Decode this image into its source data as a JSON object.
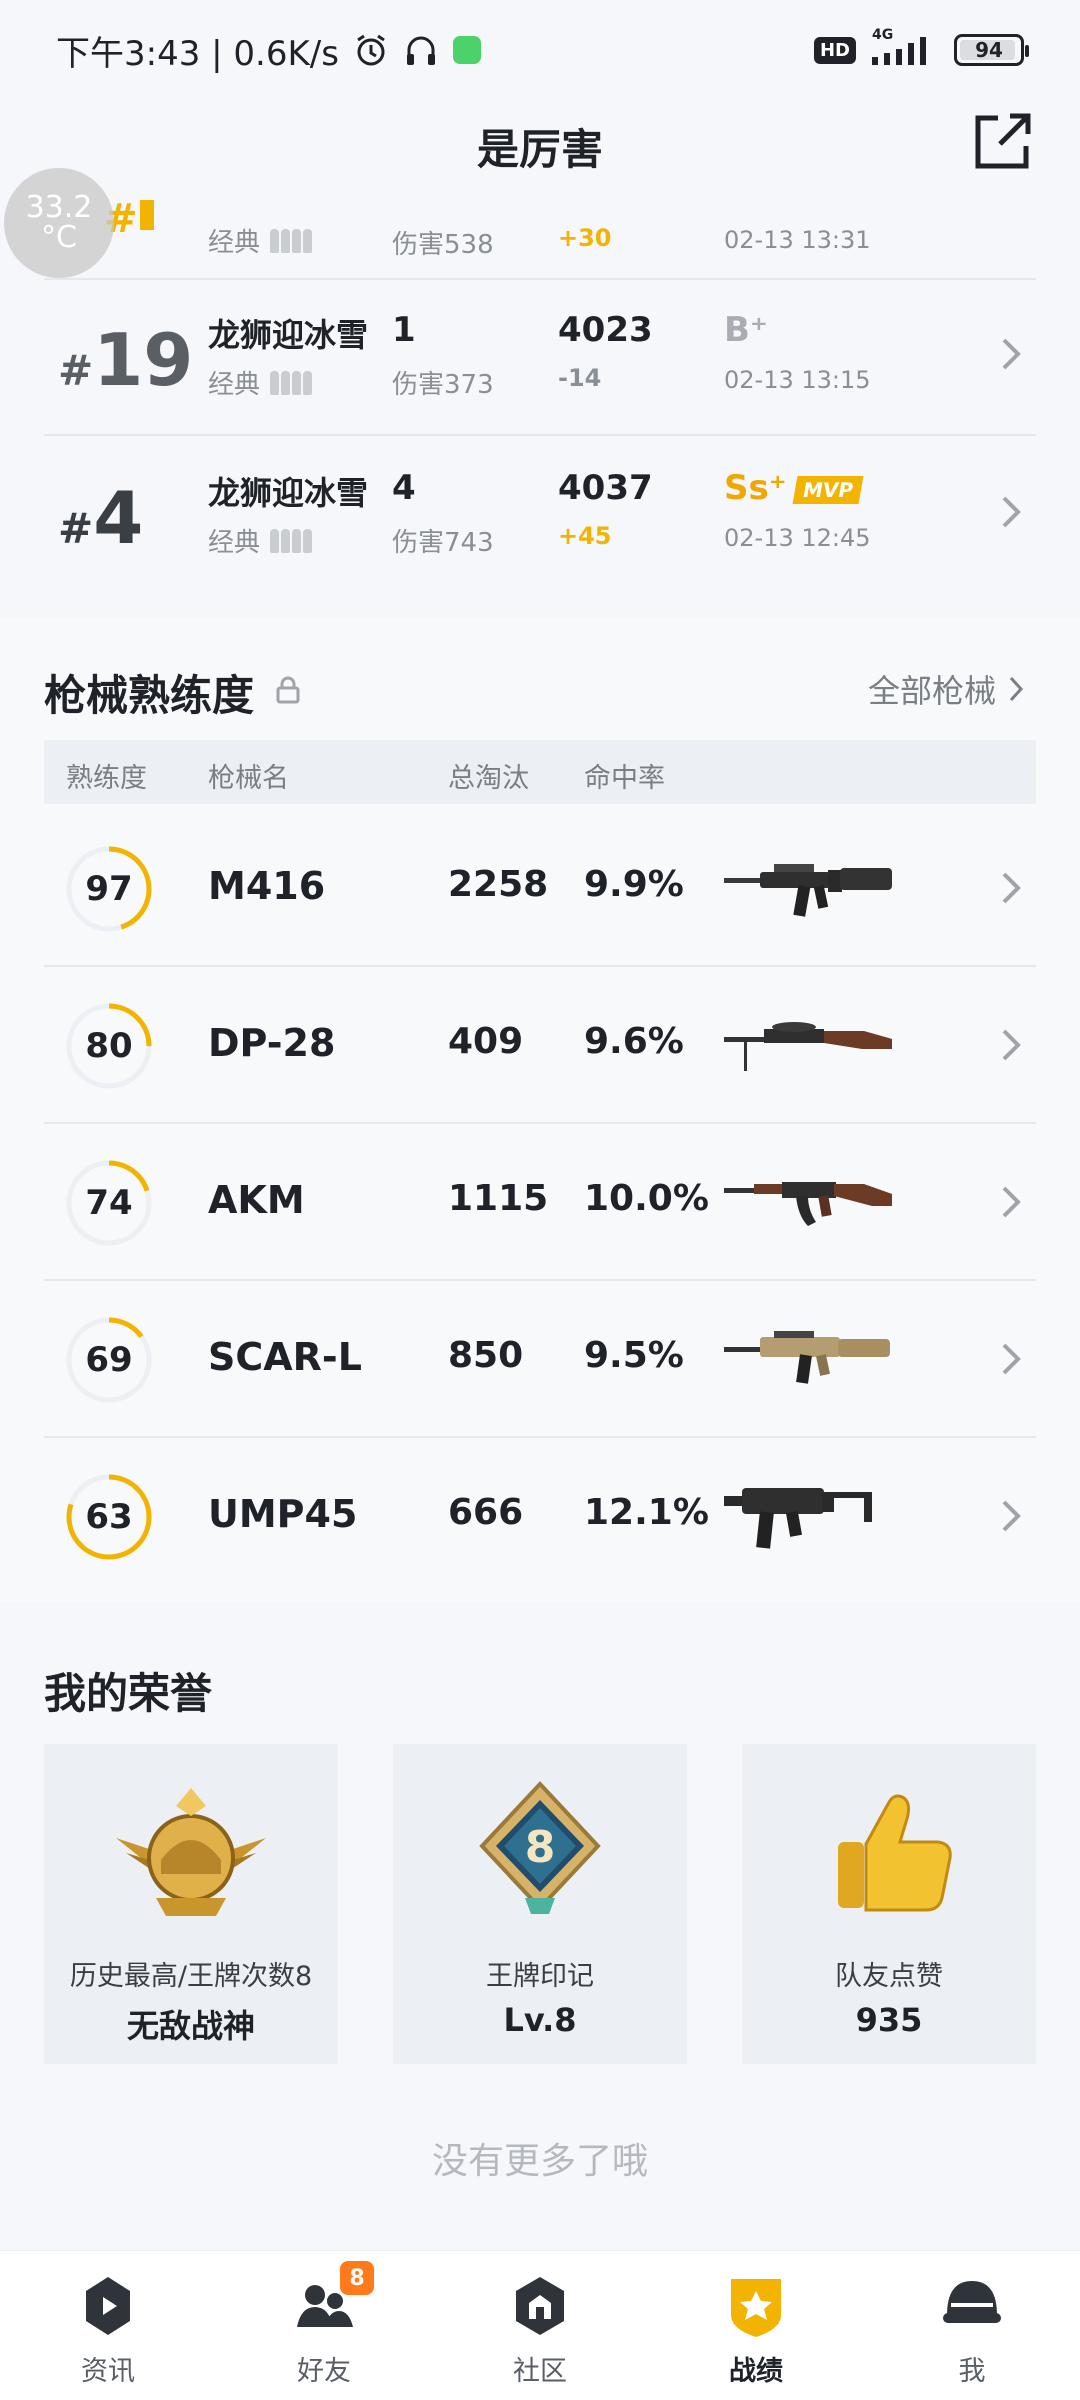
{
  "status_bar": {
    "time_speed": "下午3:43 | 0.6K/s",
    "hd": "HD",
    "net": "4G",
    "battery": "94",
    "battery_level": 0.94
  },
  "header": {
    "title": "是厉害"
  },
  "temp_overlay": {
    "value": "33.2",
    "unit": "°C"
  },
  "matches": [
    {
      "rank_hash": "#",
      "rank": "",
      "mode_sub": "经典",
      "damage": "伤害538",
      "delta": "+30",
      "delta_up": true,
      "time": "02-13 13:31"
    },
    {
      "rank_hash": "#",
      "rank": "19",
      "mode": "龙狮迎冰雪",
      "mode_sub": "经典",
      "kills": "1",
      "damage": "伤害373",
      "score": "4023",
      "delta": "-14",
      "delta_up": false,
      "grade": "B⁺",
      "time": "02-13 13:15"
    },
    {
      "rank_hash": "#",
      "rank": "4",
      "mode": "龙狮迎冰雪",
      "mode_sub": "经典",
      "kills": "4",
      "damage": "伤害743",
      "score": "4037",
      "delta": "+45",
      "delta_up": true,
      "grade": "Ss⁺",
      "mvp": "MVP",
      "time": "02-13 12:45"
    }
  ],
  "weapons_section": {
    "title": "枪械熟练度",
    "all_link": "全部枪械",
    "headers": {
      "proficiency": "熟练度",
      "name": "枪械名",
      "kills": "总淘汰",
      "accuracy": "命中率"
    },
    "rows": [
      {
        "proficiency": "97",
        "name": "M416",
        "kills": "2258",
        "accuracy": "9.9%",
        "ring_fill": 0.45
      },
      {
        "proficiency": "80",
        "name": "DP-28",
        "kills": "409",
        "accuracy": "9.6%",
        "ring_fill": 0.25
      },
      {
        "proficiency": "74",
        "name": "AKM",
        "kills": "1115",
        "accuracy": "10.0%",
        "ring_fill": 0.2
      },
      {
        "proficiency": "69",
        "name": "SCAR-L",
        "kills": "850",
        "accuracy": "9.5%",
        "ring_fill": 0.15
      },
      {
        "proficiency": "63",
        "name": "UMP45",
        "kills": "666",
        "accuracy": "12.1%",
        "ring_fill": 0.8
      }
    ]
  },
  "honors": {
    "title": "我的荣誉",
    "cards": [
      {
        "label": "历史最高/王牌次数8",
        "value": "无敌战神",
        "icon": "conqueror-badge-icon"
      },
      {
        "label": "王牌印记",
        "value": "Lv.8",
        "icon": "ace-mark-icon",
        "emblem_number": "8"
      },
      {
        "label": "队友点赞",
        "value": "935",
        "icon": "thumbs-up-icon"
      }
    ],
    "no_more": "没有更多了哦"
  },
  "bottom_nav": {
    "items": [
      {
        "label": "资讯",
        "icon": "news-icon"
      },
      {
        "label": "好友",
        "icon": "friends-icon",
        "badge": "8"
      },
      {
        "label": "社区",
        "icon": "community-icon"
      },
      {
        "label": "战绩",
        "icon": "record-icon",
        "active": true
      },
      {
        "label": "我",
        "icon": "profile-helmet-icon"
      }
    ]
  },
  "colors": {
    "accent": "#f2b400",
    "background": "#f5f7fa",
    "text": "#1f2329",
    "muted": "#8a8f96",
    "badge": "#ff7a1a"
  }
}
